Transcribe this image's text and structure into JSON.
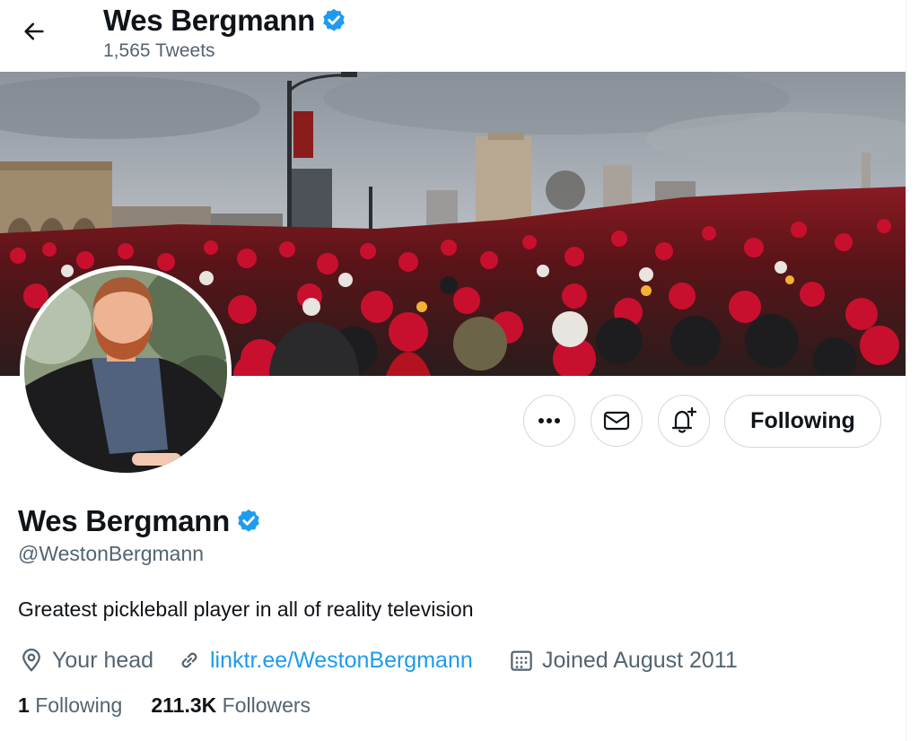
{
  "header": {
    "name": "Wes Bergmann",
    "tweet_count": "1,565 Tweets",
    "back_icon": "arrow-left-icon"
  },
  "profile": {
    "name": "Wes Bergmann",
    "verified": true,
    "handle": "@WestonBergmann",
    "bio": "Greatest pickleball player in all of reality television",
    "location": "Your head",
    "website": "linktr.ee/WestonBergmann",
    "joined": "Joined August 2011"
  },
  "actions": {
    "more_icon": "more-dots-icon",
    "message_icon": "envelope-icon",
    "notify_icon": "bell-plus-icon",
    "follow_label": "Following"
  },
  "stats": {
    "following_count": "1",
    "following_label": "Following",
    "followers_count": "211.3K",
    "followers_label": "Followers"
  },
  "colors": {
    "accent": "#1d9bf0",
    "verified": "#1d9bf0",
    "secondary_text": "#536471",
    "border": "#cfd9de",
    "crowd_red": "#c8102e"
  }
}
